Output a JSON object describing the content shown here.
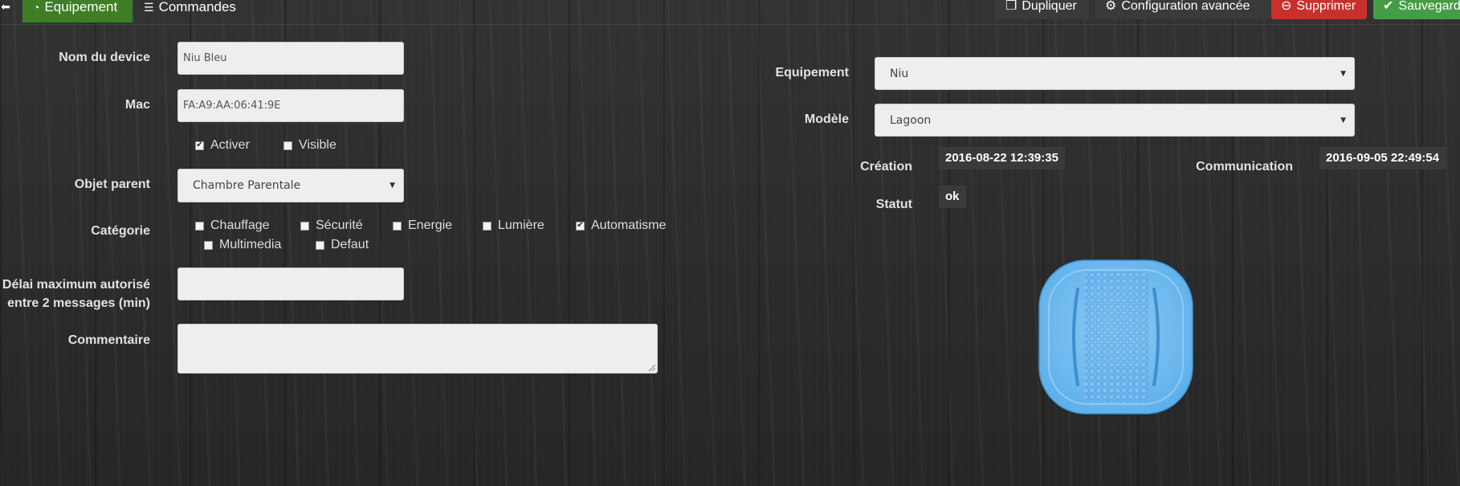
{
  "topbar": {
    "back_icon": "arrow-circle-left-icon",
    "tabs": [
      {
        "label": "Equipement",
        "icon": "dashboard-icon",
        "active": true
      },
      {
        "label": "Commandes",
        "icon": "list-icon",
        "active": false
      }
    ],
    "buttons": {
      "duplicate": "Dupliquer",
      "advanced": "Configuration avancée",
      "delete": "Supprimer",
      "save": "Sauvegarder"
    },
    "colors": {
      "active_tab": "#3e7e24",
      "delete": "#c9302c",
      "save": "#449d44"
    }
  },
  "form": {
    "device_name": {
      "label": "Nom du device",
      "value": "Niu Bleu"
    },
    "mac": {
      "label": "Mac",
      "value": "FA:A9:AA:06:41:9E"
    },
    "flags": [
      {
        "label": "Activer",
        "checked": true
      },
      {
        "label": "Visible",
        "checked": false
      }
    ],
    "parent": {
      "label": "Objet parent",
      "value": "Chambre Parentale"
    },
    "category": {
      "label": "Catégorie",
      "options": [
        {
          "label": "Chauffage",
          "checked": false
        },
        {
          "label": "Sécurité",
          "checked": false
        },
        {
          "label": "Energie",
          "checked": false
        },
        {
          "label": "Lumière",
          "checked": false
        },
        {
          "label": "Automatisme",
          "checked": true
        },
        {
          "label": "Multimedia",
          "checked": false
        },
        {
          "label": "Defaut",
          "checked": false
        }
      ]
    },
    "timeout": {
      "label_line1": "Délai maximum autorisé",
      "label_line2": "entre 2 messages (min)",
      "value": ""
    },
    "comment": {
      "label": "Commentaire",
      "value": ""
    }
  },
  "details": {
    "equipment": {
      "label": "Equipement",
      "value": "Niu"
    },
    "model": {
      "label": "Modèle",
      "value": "Lagoon"
    },
    "creation": {
      "label": "Création",
      "value": "2016-08-22 12:39:35"
    },
    "communication": {
      "label": "Communication",
      "value": "2016-09-05 22:49:54"
    },
    "status": {
      "label": "Statut",
      "value": "ok"
    },
    "device_color": "#6fb8ee"
  }
}
